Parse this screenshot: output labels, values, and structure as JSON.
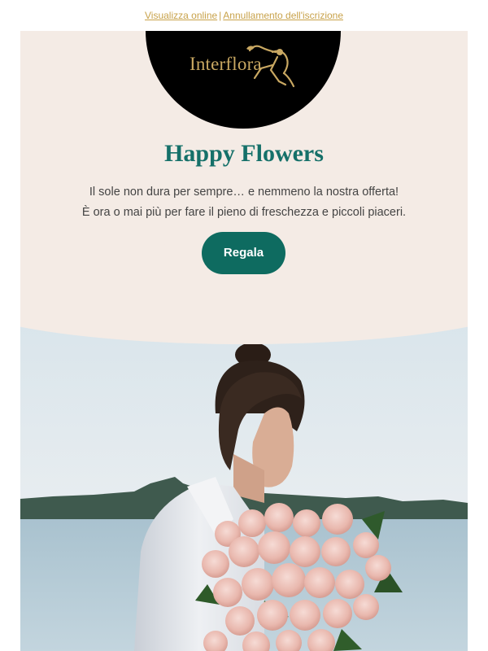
{
  "preheader": {
    "view_online": "Visualizza online",
    "separator": "|",
    "unsubscribe": "Annullamento dell'iscrizione"
  },
  "brand": {
    "logo_text": "Interflora",
    "logo_icon": "mercury-messenger-logo",
    "gold": "#c9a862"
  },
  "hero": {
    "title": "Happy Flowers",
    "line1": "Il sole non dura per sempre… e nemmeno la nostra offerta!",
    "line2": "È ora o mai più per fare il pieno di freschezza e piccoli piaceri.",
    "cta_label": "Regala",
    "title_color": "#157069",
    "cta_color": "#0e6b60",
    "panel_color": "#f4ebe5"
  }
}
